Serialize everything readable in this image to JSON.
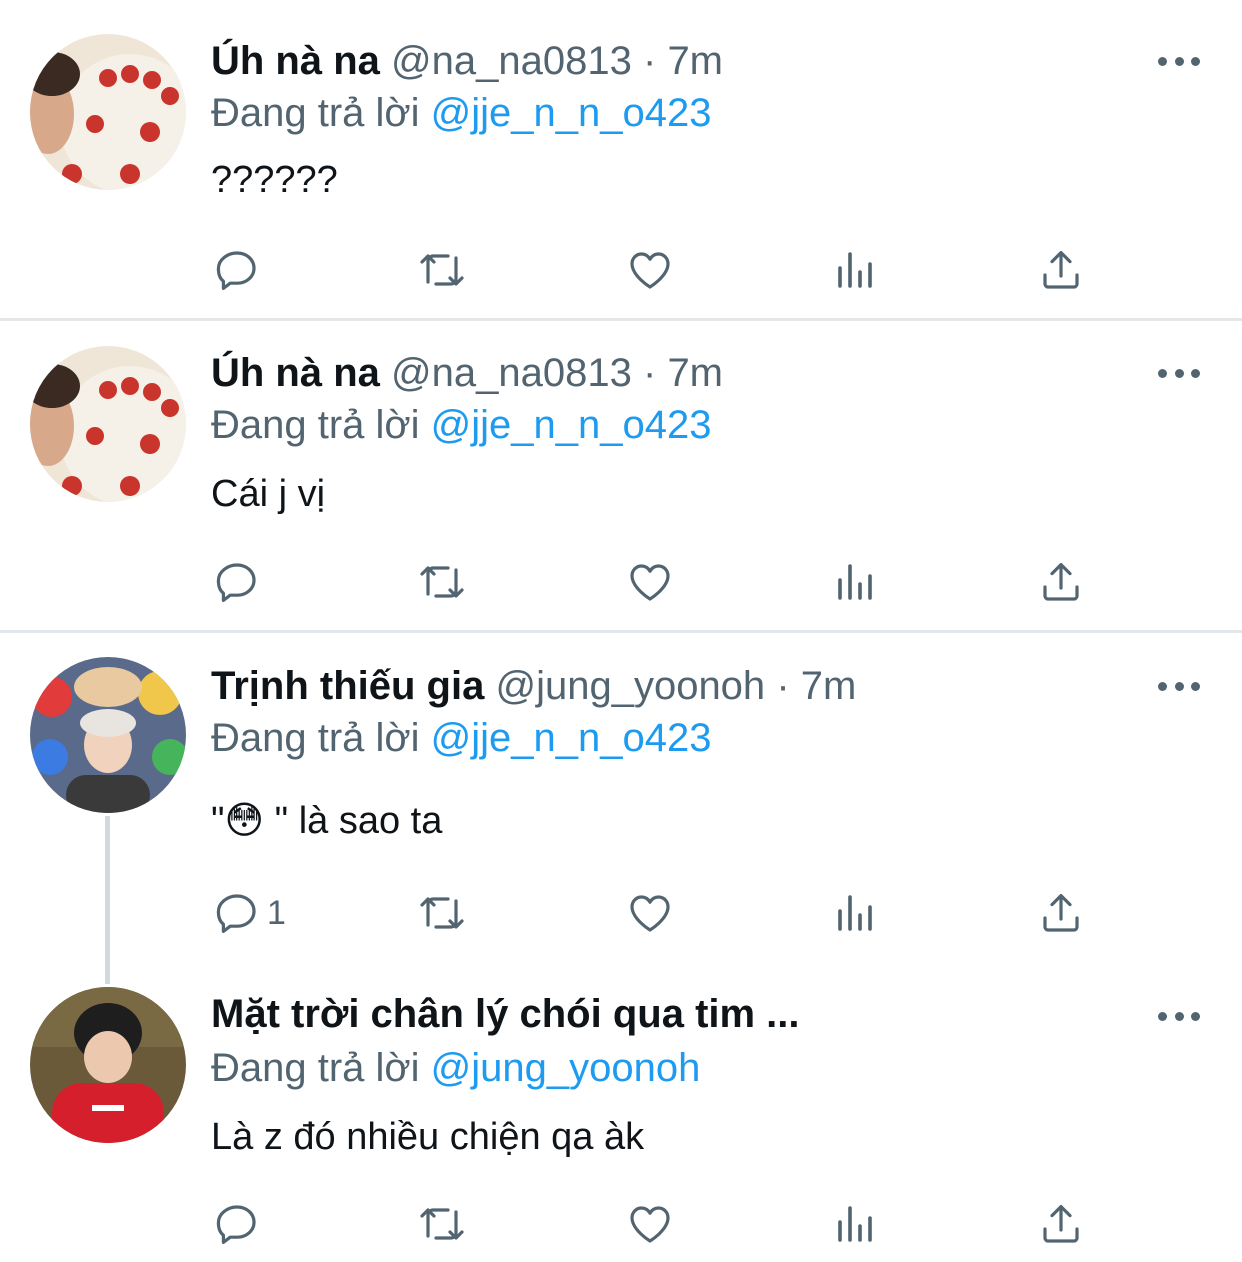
{
  "replying_prefix": "Đang trả lời",
  "tweets": [
    {
      "name": "Úh nà na",
      "handle": "@na_na0813",
      "separator": "·",
      "time": "7m",
      "reply_to": "@jje_n_n_o423",
      "text": "??????",
      "reply_count": ""
    },
    {
      "name": "Úh nà na",
      "handle": "@na_na0813",
      "separator": "·",
      "time": "7m",
      "reply_to": "@jje_n_n_o423",
      "text": "Cái j vị",
      "reply_count": ""
    },
    {
      "name": "Trịnh thiếu gia",
      "handle": "@jung_yoonoh",
      "separator": "·",
      "time": "7m",
      "reply_to": "@jje_n_n_o423",
      "text": "\"😳 \" là sao ta",
      "reply_count": "1"
    },
    {
      "name": "Mặt trời chân lý chói qua tim ...",
      "handle": "",
      "separator": "",
      "time": "",
      "reply_to": "@jung_yoonoh",
      "text": "Là z đó nhiều chiện qa àk",
      "reply_count": ""
    }
  ],
  "icons": {
    "reply": "reply-icon",
    "retweet": "retweet-icon",
    "like": "heart-icon",
    "views": "analytics-icon",
    "share": "share-icon",
    "more": "more-icon"
  },
  "colors": {
    "accent": "#1d9bf0",
    "secondary_text": "#536471",
    "primary_text": "#0f1419",
    "divider": "#e4e7ea",
    "thread_line": "#cfd9de"
  }
}
